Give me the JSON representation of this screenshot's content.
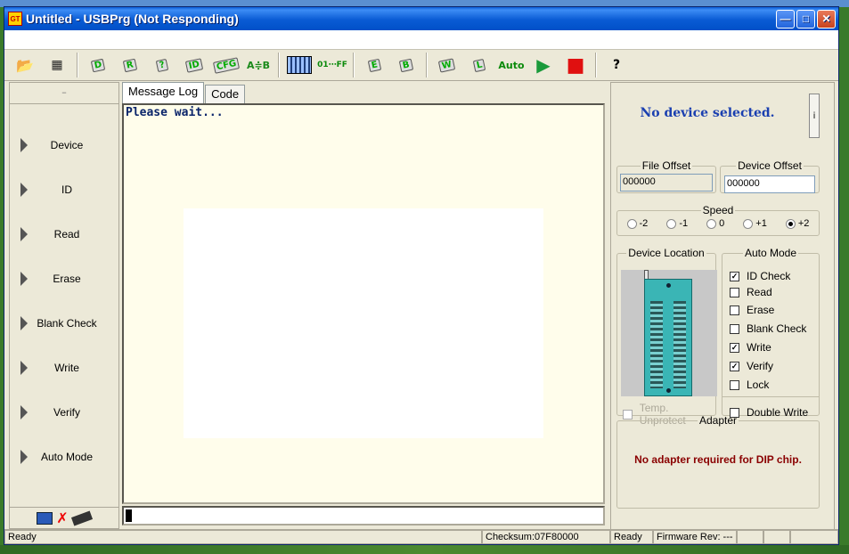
{
  "window": {
    "title": "Untitled - USBPrg (Not Responding)",
    "app_icon": "chip-programmer-icon",
    "controls": [
      "minimize-icon",
      "maximize-icon",
      "close-icon"
    ]
  },
  "toolbar": {
    "open_icon": "folder-open-icon",
    "save_icon": "floppy-save-icon",
    "tools": [
      {
        "name": "device-select-tool",
        "label": "D"
      },
      {
        "name": "read-tool",
        "label": "R"
      },
      {
        "name": "blank-check-tool",
        "label": "?"
      },
      {
        "name": "id-tool",
        "label": "ID"
      },
      {
        "name": "config-tool",
        "label": "CFG"
      },
      {
        "name": "compare-tool",
        "label": "A≑B"
      },
      {
        "name": "calculator-tool",
        "label": ""
      },
      {
        "name": "hex-fill-tool",
        "label": "01⋯FF"
      },
      {
        "name": "erase-tool",
        "label": "E"
      },
      {
        "name": "blank-tool",
        "label": "B"
      },
      {
        "name": "write-tool",
        "label": "W"
      },
      {
        "name": "lock-tool",
        "label": "L"
      },
      {
        "name": "auto-tool",
        "label": "Auto"
      },
      {
        "name": "run-tool",
        "label": "▶"
      },
      {
        "name": "stop-tool",
        "label": "■"
      },
      {
        "name": "help-tool",
        "label": "?"
      }
    ]
  },
  "sidebar": {
    "collapse_label": "–",
    "items": [
      {
        "label": "Device"
      },
      {
        "label": "ID"
      },
      {
        "label": "Read"
      },
      {
        "label": "Erase"
      },
      {
        "label": "Blank Check"
      },
      {
        "label": "Write"
      },
      {
        "label": "Verify"
      },
      {
        "label": "Auto Mode"
      }
    ]
  },
  "tabs": [
    {
      "label": "Message Log",
      "active": true
    },
    {
      "label": "Code",
      "active": false
    }
  ],
  "log": {
    "text": "Please wait..."
  },
  "right_panel": {
    "device_status": "No device selected.",
    "info_button": "i",
    "file_offset": {
      "label": "File Offset",
      "value": "000000"
    },
    "device_offset": {
      "label": "Device Offset",
      "value": "000000"
    },
    "speed": {
      "label": "Speed",
      "options": [
        "-2",
        "-1",
        "0",
        "+1",
        "+2"
      ],
      "selected": "+2"
    },
    "device_location": {
      "label": "Device Location",
      "temp_unprotect": "Temp. Unprotect"
    },
    "auto_mode": {
      "label": "Auto Mode",
      "items": [
        {
          "label": "ID Check",
          "checked": true
        },
        {
          "label": "Read",
          "checked": false
        },
        {
          "label": "Erase",
          "checked": false
        },
        {
          "label": "Blank Check",
          "checked": false
        },
        {
          "label": "Write",
          "checked": true
        },
        {
          "label": "Verify",
          "checked": true
        },
        {
          "label": "Lock",
          "checked": false
        }
      ],
      "double_write": {
        "label": "Double Write",
        "checked": false
      }
    },
    "adapter": {
      "label": "Adapter",
      "message": "No adapter required for DIP chip."
    }
  },
  "statusbar": {
    "status": "Ready",
    "checksum": "Checksum:07F80000",
    "state": "Ready",
    "firmware": "Firmware Rev: ---"
  },
  "colors": {
    "log_bg": "#fffdeb",
    "device_status": "#1a3fb0",
    "adapter_msg": "#8a0000"
  }
}
